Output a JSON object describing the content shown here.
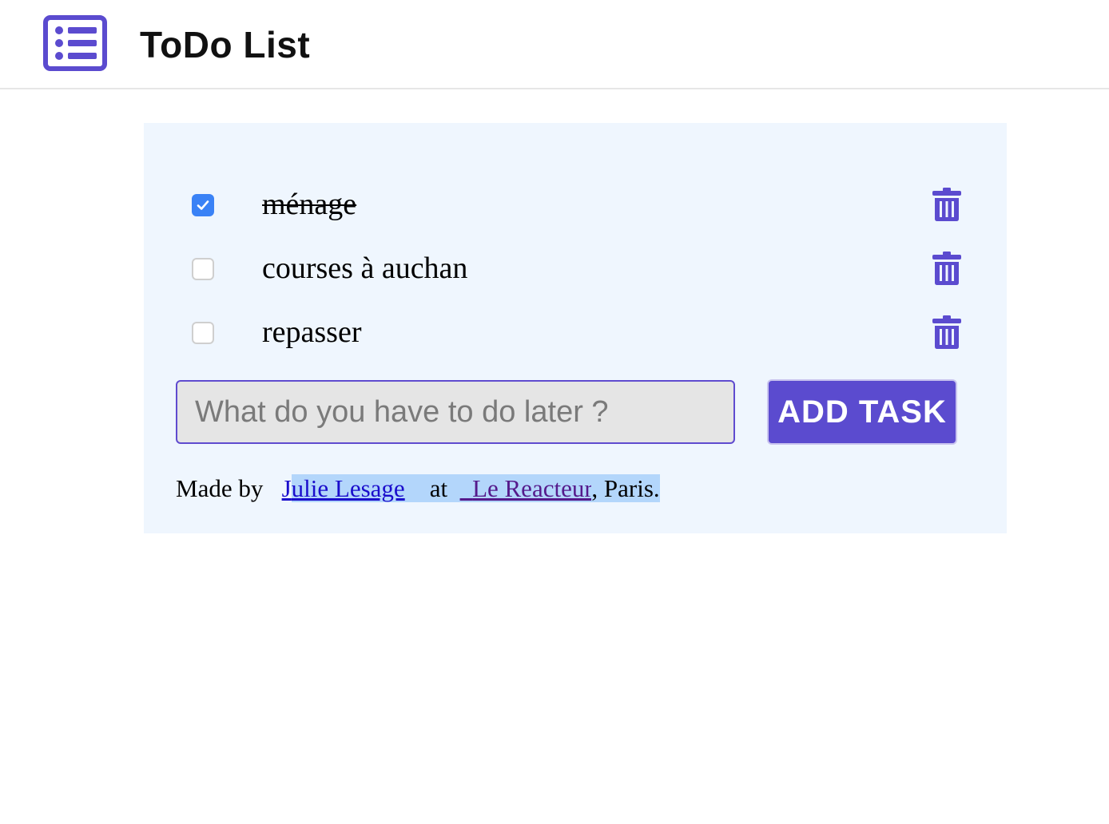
{
  "header": {
    "title": "ToDo List",
    "logo_icon": "list-icon",
    "accent_color": "#5b4bcf"
  },
  "tasks": [
    {
      "label": "ménage",
      "done": true
    },
    {
      "label": "courses à auchan",
      "done": false
    },
    {
      "label": "repasser",
      "done": false
    }
  ],
  "form": {
    "input_placeholder": "What do you have to do later ?",
    "input_value": "",
    "add_label": "ADD TASK"
  },
  "footer": {
    "prefix": "Made by",
    "author": "Julie Lesage",
    "middle": "at",
    "school": "Le Reacteur",
    "suffix": ", Paris."
  }
}
